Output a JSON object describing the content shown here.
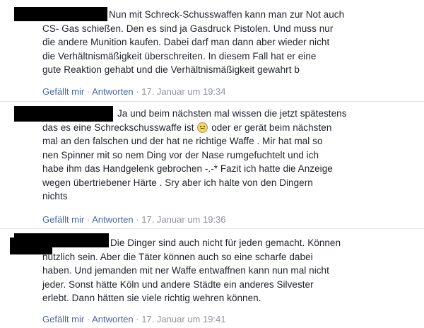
{
  "comments": [
    {
      "lines": [
        "Nun mit Schreck-Schusswaffen kann man zur Not auch",
        "CS- Gas schießen. Den es sind ja Gasdruck Pistolen. Und muss nur",
        "die andere Munition kaufen. Dabei darf man dann aber wieder nicht",
        "die Verhältnismäßigkeit überschreiten. In diesem Fall hat er eine",
        "gute Reaktion gehabt und die Verhältnismäßigkeit gewahrt b"
      ],
      "like": "Gefällt mir",
      "reply": "Antworten",
      "time": "17. Januar um 19:34"
    },
    {
      "lines": [
        "Ja und beim nächsten mal wissen die jetzt spätestens",
        "das es eine Schreckschusswaffe ist",
        "mal an den falschen und der hat ne richtige Waffe . Mir hat mal so",
        "nen Spinner mit so nem Ding vor der Nase rumgefuchtelt und ich",
        "habe ihm das Handgelenk gebrochen -.-* Fazit ich hatte die Anzeige",
        "wegen übertriebener Härte . Sry aber ich halte von den Dingern",
        "nichts"
      ],
      "line2_after_emoji": "oder er gerät beim nächsten",
      "emoji": "confused-face-icon",
      "like": "Gefällt mir",
      "reply": "Antworten",
      "time": "17. Januar um 19:36"
    },
    {
      "lines": [
        "Die Dinger sind auch nicht für jeden gemacht. Können",
        "nützlich sein. Aber die Täter können auch so eine scharfe dabei",
        "haben. Und jemanden mit ner Waffe entwaffnen kann nun mal nicht",
        "jeder. Sonst hätte Köln und andere Städte ein anderes Silvester",
        "erlebt. Dann hätten sie viele richtig wehren können."
      ],
      "like": "Gefällt mir",
      "reply": "Antworten",
      "time": "17. Januar um 19:41"
    }
  ],
  "separator": "·"
}
